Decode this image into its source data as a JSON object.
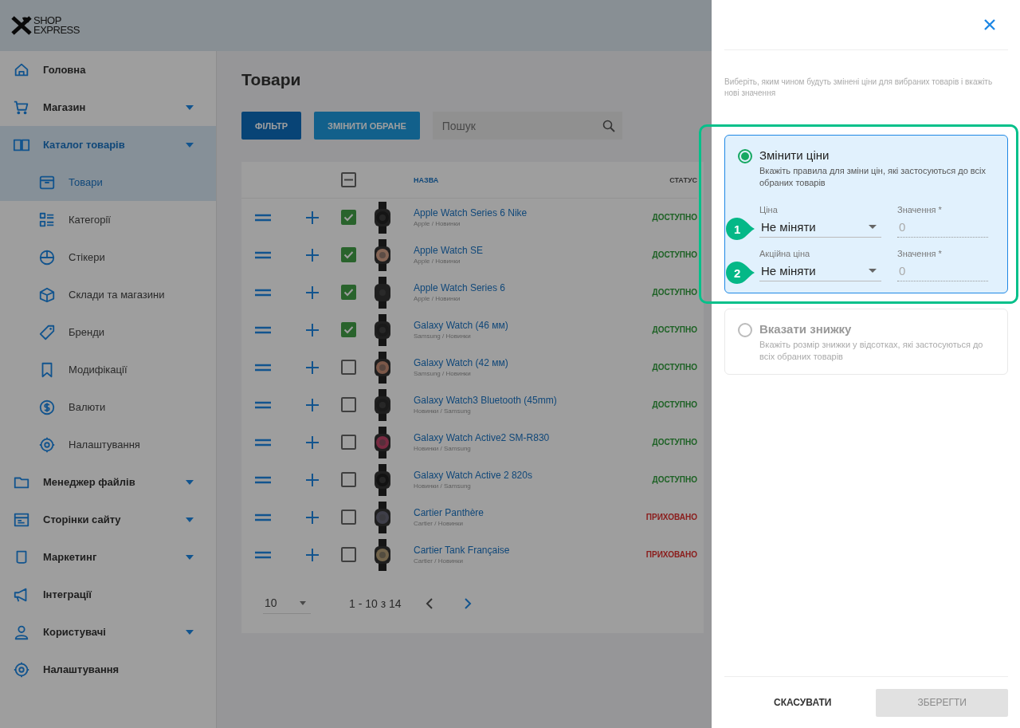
{
  "logo": {
    "line_1": "SHOP",
    "line_2": "EXPRESS"
  },
  "sidebar": {
    "items": [
      {
        "label": "Головна",
        "expandable": false,
        "selected": false
      },
      {
        "label": "Магазин",
        "expandable": true,
        "selected": false
      },
      {
        "label": "Каталог товарів",
        "expandable": true,
        "selected": true,
        "children": [
          {
            "label": "Товари",
            "selected": true
          },
          {
            "label": "Категорії",
            "selected": false
          },
          {
            "label": "Стікери",
            "selected": false
          },
          {
            "label": "Склади та магазини",
            "selected": false
          },
          {
            "label": "Бренди",
            "selected": false
          },
          {
            "label": "Модифікації",
            "selected": false
          },
          {
            "label": "Валюти",
            "selected": false
          },
          {
            "label": "Налаштування",
            "selected": false
          }
        ]
      },
      {
        "label": "Менеджер файлів",
        "expandable": true,
        "selected": false
      },
      {
        "label": "Сторінки сайту",
        "expandable": true,
        "selected": false
      },
      {
        "label": "Маркетинг",
        "expandable": true,
        "selected": false
      },
      {
        "label": "Інтеграції",
        "expandable": false,
        "selected": false
      },
      {
        "label": "Користувачі",
        "expandable": true,
        "selected": false
      },
      {
        "label": "Налаштування",
        "expandable": false,
        "selected": false
      }
    ]
  },
  "page": {
    "title": "Товари",
    "filter_button": "ФІЛЬТР",
    "edit_selected_button": "ЗМІНИТИ ОБРАНЕ",
    "search": {
      "placeholder": "Пошук"
    }
  },
  "table": {
    "select_all": {
      "indeterminate": true
    },
    "columns": [
      "НАЗВА",
      "СТАТУС"
    ],
    "rows": [
      {
        "name": "Apple Watch Series 6 Nike",
        "category": "Apple / Новинки",
        "checked": true,
        "status": "ДОСТУПНО",
        "kind": "available"
      },
      {
        "name": "Apple Watch SE",
        "category": "Apple / Новинки",
        "checked": true,
        "status": "ДОСТУПНО",
        "kind": "available"
      },
      {
        "name": "Apple Watch Series 6",
        "category": "Apple / Новинки",
        "checked": true,
        "status": "ДОСТУПНО",
        "kind": "available"
      },
      {
        "name": "Galaxy Watch (46 мм)",
        "category": "Samsung / Новинки",
        "checked": true,
        "status": "ДОСТУПНО",
        "kind": "available"
      },
      {
        "name": "Galaxy Watch (42 мм)",
        "category": "Samsung / Новинки",
        "checked": false,
        "status": "ДОСТУПНО",
        "kind": "available"
      },
      {
        "name": "Galaxy Watch3 Bluetooth (45mm)",
        "category": "Новинки / Samsung",
        "checked": false,
        "status": "ДОСТУПНО",
        "kind": "available"
      },
      {
        "name": "Galaxy Watch Active2 SM-R830",
        "category": "Новинки / Samsung",
        "checked": false,
        "status": "ДОСТУПНО",
        "kind": "available"
      },
      {
        "name": "Galaxy Watch Active 2 820s",
        "category": "Новинки / Samsung",
        "checked": false,
        "status": "ДОСТУПНО",
        "kind": "available"
      },
      {
        "name": "Cartier Panthère",
        "category": "Cartier / Новинки",
        "checked": false,
        "status": "ПРИХОВАНО",
        "kind": "hidden"
      },
      {
        "name": "Cartier Tank Française",
        "category": "Cartier / Новинки",
        "checked": false,
        "status": "ПРИХОВАНО",
        "kind": "hidden"
      }
    ],
    "page_size": "10",
    "range": "1 - 10 з 14"
  },
  "drawer": {
    "description": "Виберіть, яким чином будуть змінені ціни для вибраних товарів і вкажіть нові значення",
    "options": [
      {
        "title": "Змінити ціни",
        "description": "Вкажіть правила для зміни цін, які застосуються до всіх обраних товарів",
        "selected": true,
        "highlighted": true,
        "fields": [
          {
            "marker": "1",
            "label": "Ціна",
            "value": "Не міняти",
            "amount_label": "Значення *",
            "amount_placeholder": "0"
          },
          {
            "marker": "2",
            "label": "Акційна ціна",
            "value": "Не міняти",
            "amount_label": "Значення *",
            "amount_placeholder": "0"
          }
        ]
      },
      {
        "title": "Вказати знижку",
        "description": "Вкажіть розмір знижки у відсотках, які застосуються до всіх обраних товарів",
        "selected": false,
        "highlighted": false
      }
    ],
    "cancel_button": "СКАСУВАТИ",
    "save_button": {
      "label": "ЗБЕРЕГТИ",
      "disabled": true
    }
  }
}
